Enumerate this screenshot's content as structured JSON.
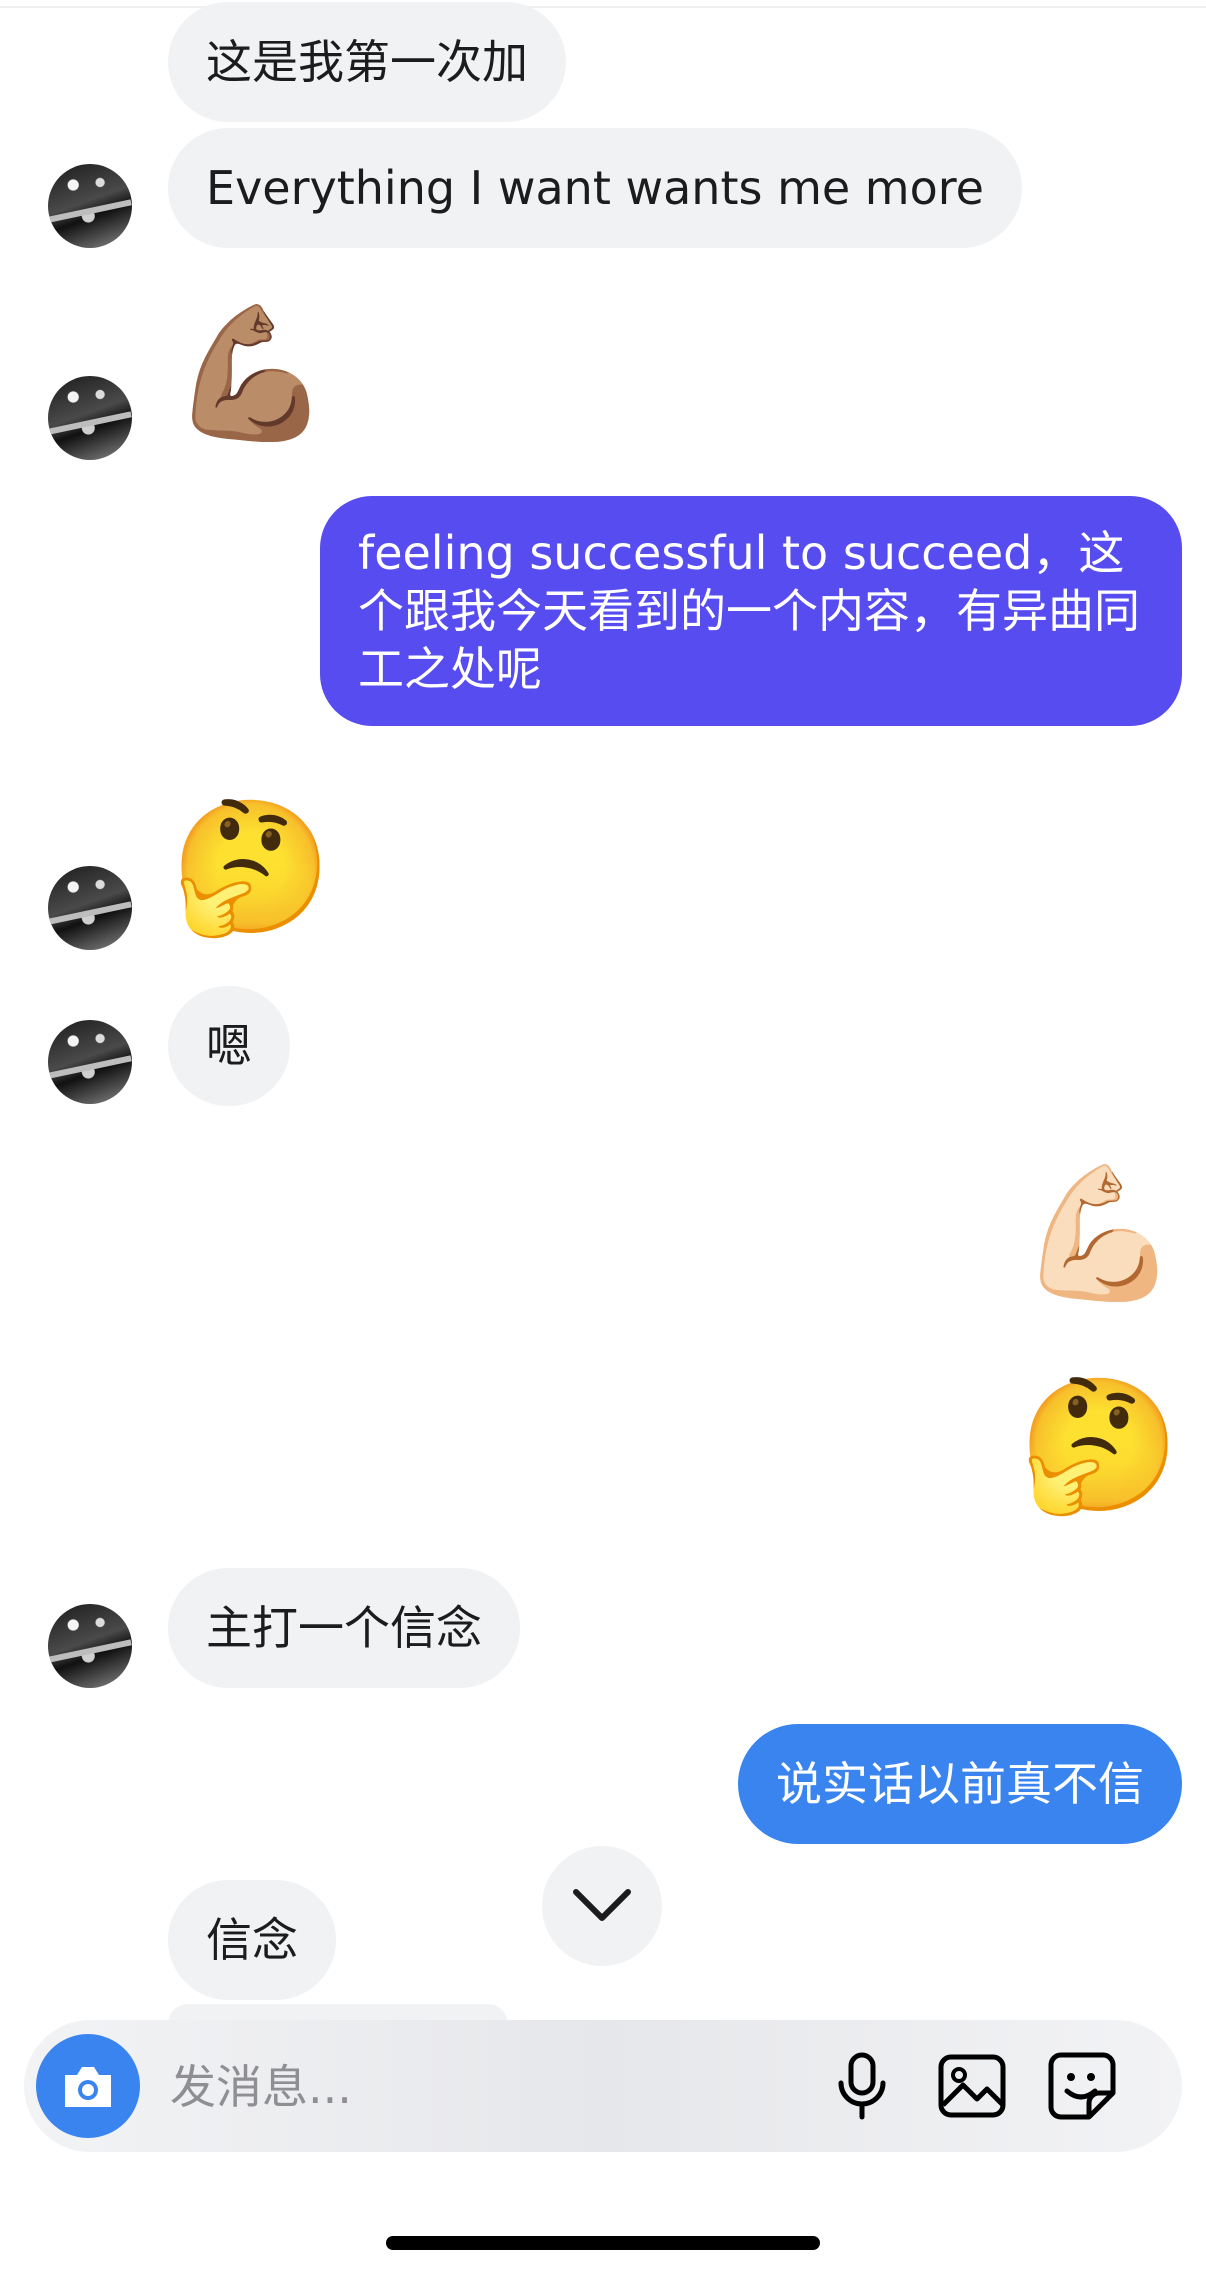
{
  "messages": [
    {
      "direction": "incoming",
      "type": "text",
      "text": "这是我第一次加"
    },
    {
      "direction": "incoming",
      "type": "text",
      "text": "Everything I want wants me more"
    },
    {
      "direction": "incoming",
      "type": "emoji",
      "text": "💪🏽"
    },
    {
      "direction": "outgoing",
      "type": "text",
      "text": "feeling successful to succeed，这个跟我今天看到的一个内容，有异曲同工之处呢"
    },
    {
      "direction": "incoming",
      "type": "emoji",
      "text": "🤔"
    },
    {
      "direction": "incoming",
      "type": "text",
      "text": "嗯"
    },
    {
      "direction": "outgoing",
      "type": "emoji",
      "text": "💪🏻"
    },
    {
      "direction": "outgoing",
      "type": "emoji",
      "text": "🤔"
    },
    {
      "direction": "incoming",
      "type": "text",
      "text": "主打一个信念"
    },
    {
      "direction": "outgoing",
      "type": "text",
      "text": "说实话以前真不信"
    },
    {
      "direction": "incoming",
      "type": "text",
      "text": "信念"
    }
  ],
  "composer": {
    "placeholder": "发消息..."
  },
  "icons": {
    "scroll_down": "chevron-down-icon",
    "camera": "camera-icon",
    "microphone": "microphone-icon",
    "image": "image-icon",
    "sticker": "sticker-icon"
  },
  "colors": {
    "incoming_bubble": "#f1f2f4",
    "outgoing_purple": "#564cf0",
    "outgoing_blue": "#3a84f0",
    "accent": "#3a84f0"
  }
}
